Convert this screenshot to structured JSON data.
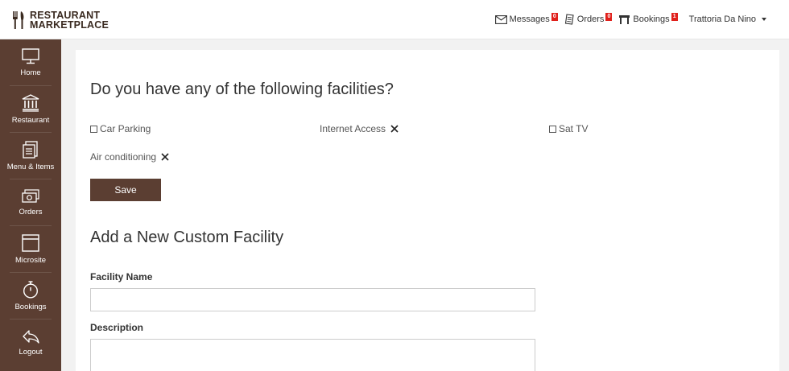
{
  "brand": {
    "line1": "RESTAURANT",
    "line2": "MARKETPLACE"
  },
  "topnav": {
    "messages": {
      "label": "Messages",
      "count": "0"
    },
    "orders": {
      "label": "Orders",
      "count": "0"
    },
    "bookings": {
      "label": "Bookings",
      "count": "1"
    },
    "user": "Trattoria Da Nino"
  },
  "sidebar": {
    "items": [
      {
        "label": "Home",
        "icon": "monitor-icon"
      },
      {
        "label": "Restaurant",
        "icon": "building-icon"
      },
      {
        "label": "Menu & Items",
        "icon": "menu-icon"
      },
      {
        "label": "Orders",
        "icon": "money-icon"
      },
      {
        "label": "Microsite",
        "icon": "window-icon"
      },
      {
        "label": "Bookings",
        "icon": "stopwatch-icon"
      },
      {
        "label": "Logout",
        "icon": "back-arrow-icon"
      }
    ]
  },
  "facilities": {
    "heading": "Do you have any of the following facilities?",
    "items": [
      {
        "label": "Car Parking",
        "control": "checkbox",
        "checked": false
      },
      {
        "label": "Internet Access",
        "control": "remove"
      },
      {
        "label": "Sat TV",
        "control": "checkbox",
        "checked": false
      },
      {
        "label": "Air conditioning",
        "control": "remove"
      }
    ],
    "save_label": "Save"
  },
  "custom_facility": {
    "heading": "Add a New Custom Facility",
    "name_label": "Facility Name",
    "name_value": "",
    "description_label": "Description",
    "description_value": ""
  },
  "colors": {
    "brand": "#5b3e32",
    "badge": "#e0201b",
    "background": "#f2f2f2"
  }
}
